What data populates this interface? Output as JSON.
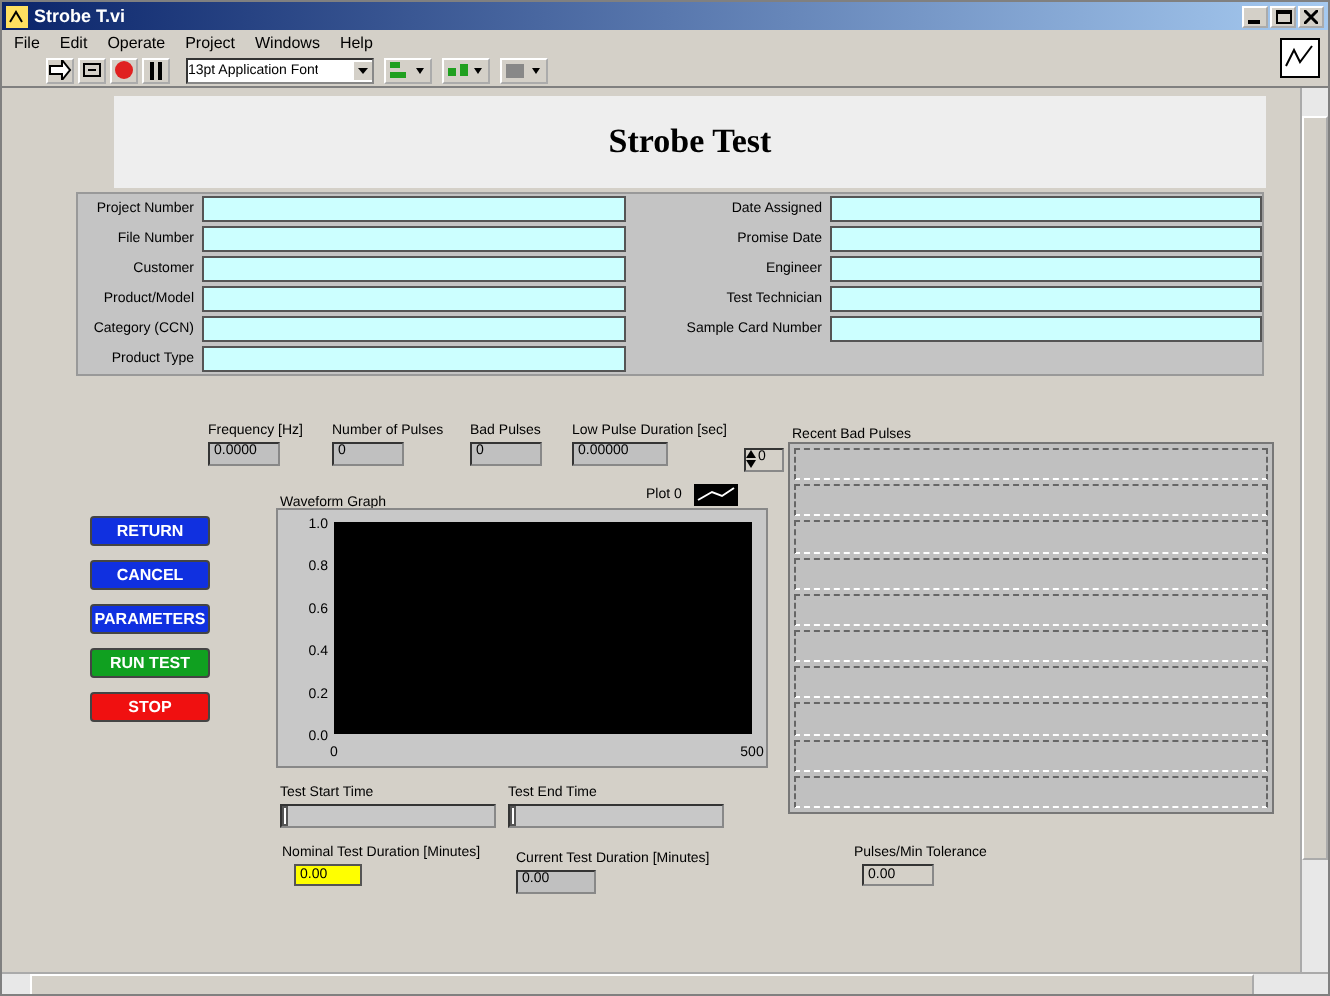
{
  "window": {
    "title": "Strobe T.vi"
  },
  "menu": [
    "File",
    "Edit",
    "Operate",
    "Project",
    "Windows",
    "Help"
  ],
  "toolbar": {
    "font": "13pt Application Font"
  },
  "header": {
    "title": "Strobe Test"
  },
  "info_left": [
    {
      "label": "Project Number"
    },
    {
      "label": "File Number"
    },
    {
      "label": "Customer"
    },
    {
      "label": "Product/Model"
    },
    {
      "label": "Category (CCN)"
    },
    {
      "label": "Product Type"
    }
  ],
  "info_right": [
    {
      "label": "Date Assigned"
    },
    {
      "label": "Promise Date"
    },
    {
      "label": "Engineer"
    },
    {
      "label": "Test Technician"
    },
    {
      "label": "Sample Card Number"
    }
  ],
  "indicators": [
    {
      "label": "Frequency [Hz]",
      "value": "0.0000"
    },
    {
      "label": "Number of Pulses",
      "value": "0"
    },
    {
      "label": "Bad Pulses",
      "value": "0"
    },
    {
      "label": "Low Pulse Duration [sec]",
      "value": "0.00000"
    }
  ],
  "buttons": [
    {
      "label": "RETURN",
      "color": "#1030e0"
    },
    {
      "label": "CANCEL",
      "color": "#1030e0"
    },
    {
      "label": "PARAMETERS",
      "color": "#1030e0"
    },
    {
      "label": "RUN TEST",
      "color": "#10a020"
    },
    {
      "label": "STOP",
      "color": "#f01010"
    }
  ],
  "graph": {
    "legend": "Plot 0",
    "chart_data": {
      "type": "line",
      "title": "Waveform Graph",
      "xlim": [
        0,
        500
      ],
      "ylim": [
        0,
        1
      ],
      "xticks": [
        0,
        500
      ],
      "yticks": [
        {
          "value": 0,
          "label": "0.0"
        },
        {
          "value": 0.2,
          "label": "0.2"
        },
        {
          "value": 0.4,
          "label": "0.4"
        },
        {
          "value": 0.6,
          "label": "0.6"
        },
        {
          "value": 0.8,
          "label": "0.8"
        },
        {
          "value": 1,
          "label": "1.0"
        }
      ]
    }
  },
  "recent_bad_pulses": {
    "label": "Recent Bad Pulses",
    "index": "0"
  },
  "slides": [
    {
      "label": "Test Start Time",
      "level": 0
    },
    {
      "label": "Test End Time",
      "level": 0
    }
  ],
  "nominal_duration": {
    "label": "Nominal Test Duration [Minutes]",
    "value": "0.00"
  },
  "current_duration": {
    "label": "Current Test Duration [Minutes]",
    "value": "0.00"
  },
  "tolerance": {
    "label": "Pulses/Min Tolerance",
    "value": "0.00"
  }
}
